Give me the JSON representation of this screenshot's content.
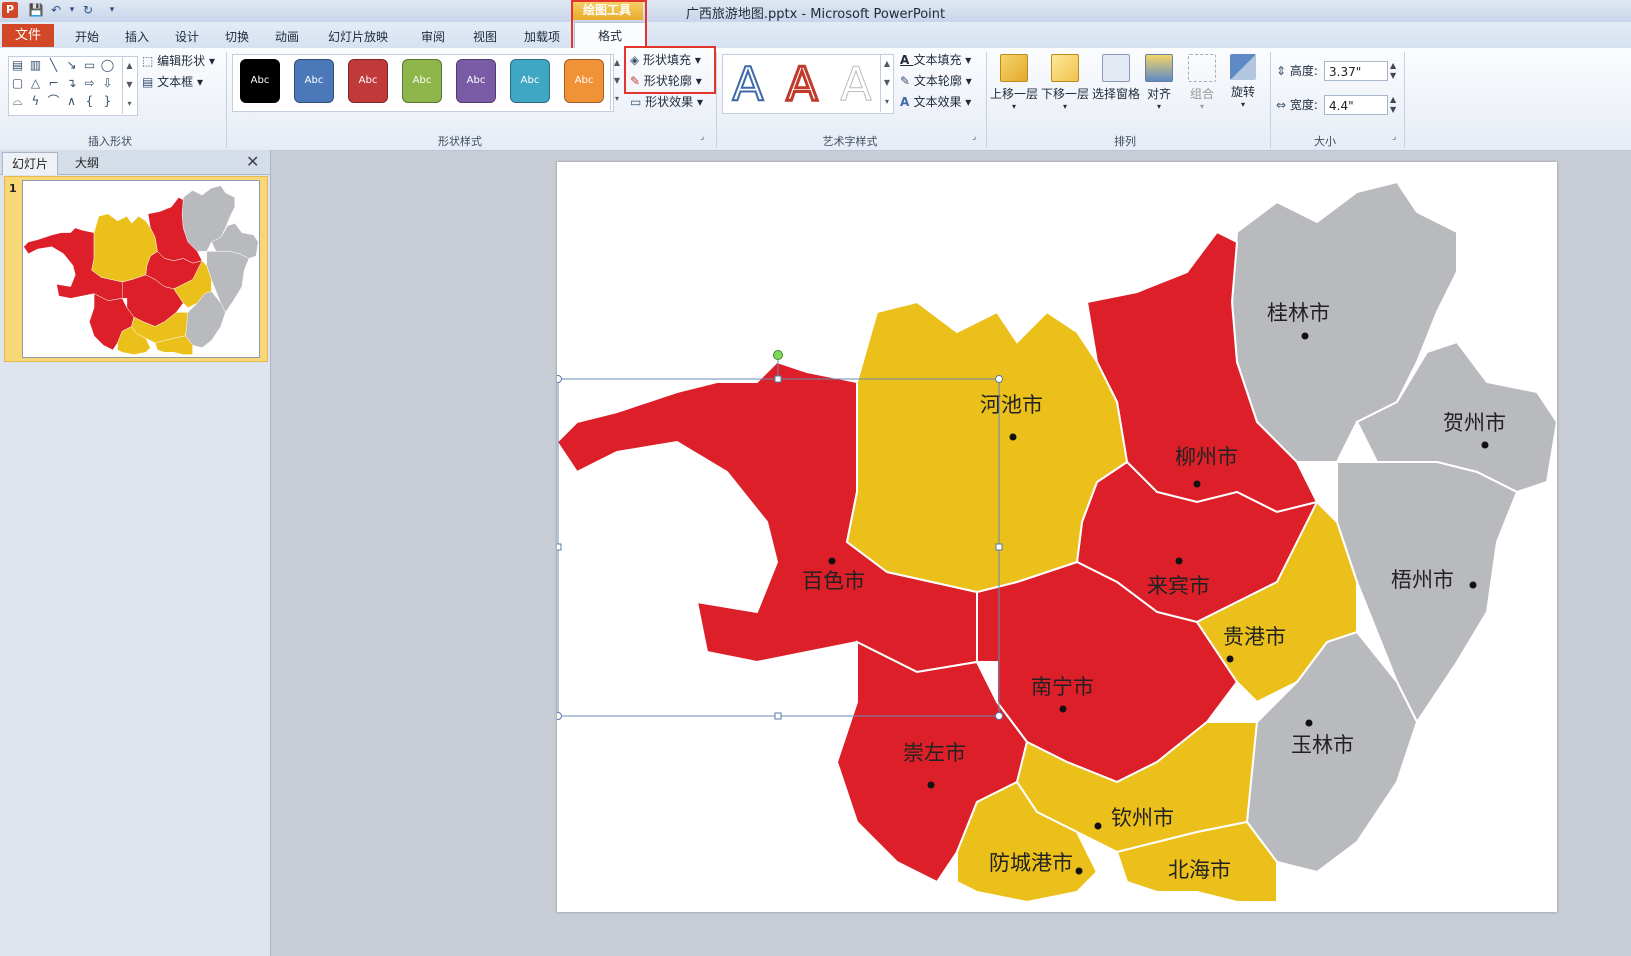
{
  "window": {
    "title": "广西旅游地图.pptx  -  Microsoft PowerPoint",
    "app_icon": "P",
    "contextual_tool": "绘图工具"
  },
  "tabs": {
    "file": "文件",
    "items": [
      "开始",
      "插入",
      "设计",
      "切换",
      "动画",
      "幻灯片放映",
      "审阅",
      "视图",
      "加载项"
    ],
    "format": "格式"
  },
  "ribbon": {
    "insert_shapes": {
      "label": "插入形状",
      "edit_shape": "编辑形状",
      "text_box": "文本框"
    },
    "shape_styles": {
      "label": "形状样式",
      "swatch_text": "Abc",
      "swatches": [
        "#000000",
        "#4a78b8",
        "#c0393b",
        "#8db54a",
        "#7a5ca6",
        "#3fa6c4",
        "#f19236"
      ],
      "fill": "形状填充",
      "outline": "形状轮廓",
      "effects": "形状效果"
    },
    "wordart_styles": {
      "label": "艺术字样式",
      "letter": "A",
      "text_fill": "文本填充",
      "text_outline": "文本轮廓",
      "text_effects": "文本效果"
    },
    "arrange": {
      "label": "排列",
      "bring_forward": "上移一层",
      "send_backward": "下移一层",
      "selection_pane": "选择窗格",
      "align": "对齐",
      "group": "组合",
      "rotate": "旋转"
    },
    "size": {
      "label": "大小",
      "height_label": "高度:",
      "height_value": "3.37\"",
      "width_label": "宽度:",
      "width_value": "4.4\""
    }
  },
  "left_panel": {
    "tab_slides": "幻灯片",
    "tab_outline": "大纲",
    "slide_number": "1"
  },
  "map": {
    "colors": {
      "red": "#dc1f28",
      "yellow": "#ebc01a",
      "gray": "#b9babd"
    },
    "cities": [
      "河池市",
      "柳州市",
      "桂林市",
      "贺州市",
      "百色市",
      "来宾市",
      "梧州市",
      "贵港市",
      "南宁市",
      "玉林市",
      "崇左市",
      "钦州市",
      "防城港市",
      "北海市"
    ]
  }
}
